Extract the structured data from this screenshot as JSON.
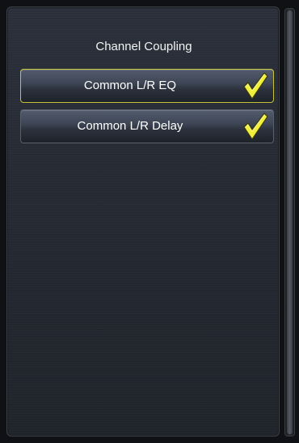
{
  "panel": {
    "title": "Channel Coupling"
  },
  "items": [
    {
      "label": "Common L/R EQ",
      "checked": true,
      "selected": true,
      "icon": "checkmark-icon"
    },
    {
      "label": "Common L/R Delay",
      "checked": true,
      "selected": false,
      "icon": "checkmark-icon"
    }
  ],
  "colors": {
    "selection_border": "#c8c23a",
    "check_fill": "#f2ef3a"
  }
}
